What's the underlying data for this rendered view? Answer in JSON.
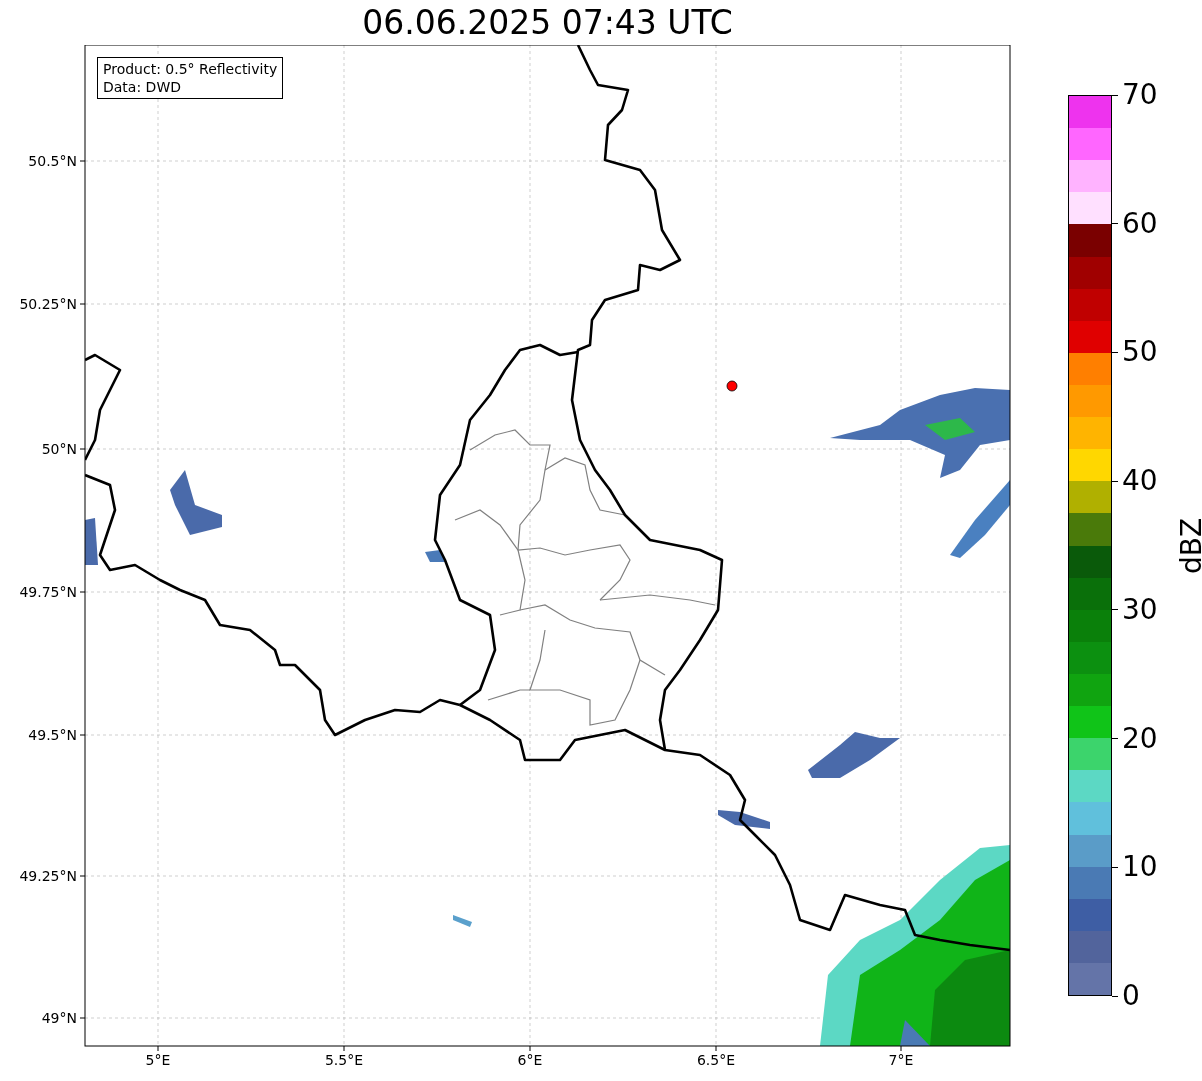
{
  "title": "06.06.2025 07:43 UTC",
  "info_box": [
    "Product: 0.5° Reflectivity",
    "Data: DWD"
  ],
  "x_ticks": [
    "5°E",
    "5.5°E",
    "6°E",
    "6.5°E",
    "7°E"
  ],
  "y_ticks": [
    "50.5°N",
    "50.25°N",
    "50°N",
    "49.75°N",
    "49.5°N",
    "49.25°N",
    "49°N"
  ],
  "colorbar": {
    "label": "dBZ",
    "ticks": [
      "70",
      "60",
      "50",
      "40",
      "30",
      "20",
      "10",
      "0"
    ],
    "bands": [
      {
        "color": "#ee33ee"
      },
      {
        "color": "#ff66ff"
      },
      {
        "color": "#ffb3ff"
      },
      {
        "color": "#ffe0ff"
      },
      {
        "color": "#7a0000"
      },
      {
        "color": "#a00000"
      },
      {
        "color": "#c00000"
      },
      {
        "color": "#e00000"
      },
      {
        "color": "#ff7f00"
      },
      {
        "color": "#ff9900"
      },
      {
        "color": "#ffb400"
      },
      {
        "color": "#ffd700"
      },
      {
        "color": "#b0b000"
      },
      {
        "color": "#4a7a0a"
      },
      {
        "color": "#0a5a0a"
      },
      {
        "color": "#0a700a"
      },
      {
        "color": "#0a800a"
      },
      {
        "color": "#0c9010"
      },
      {
        "color": "#10a410"
      },
      {
        "color": "#10c418"
      },
      {
        "color": "#3cd46c"
      },
      {
        "color": "#5cd8c4"
      },
      {
        "color": "#60c0dc"
      },
      {
        "color": "#5a9cc8"
      },
      {
        "color": "#4a7ab4"
      },
      {
        "color": "#3e5ea4"
      },
      {
        "color": "#52649c"
      },
      {
        "color": "#6474a8"
      }
    ]
  }
}
